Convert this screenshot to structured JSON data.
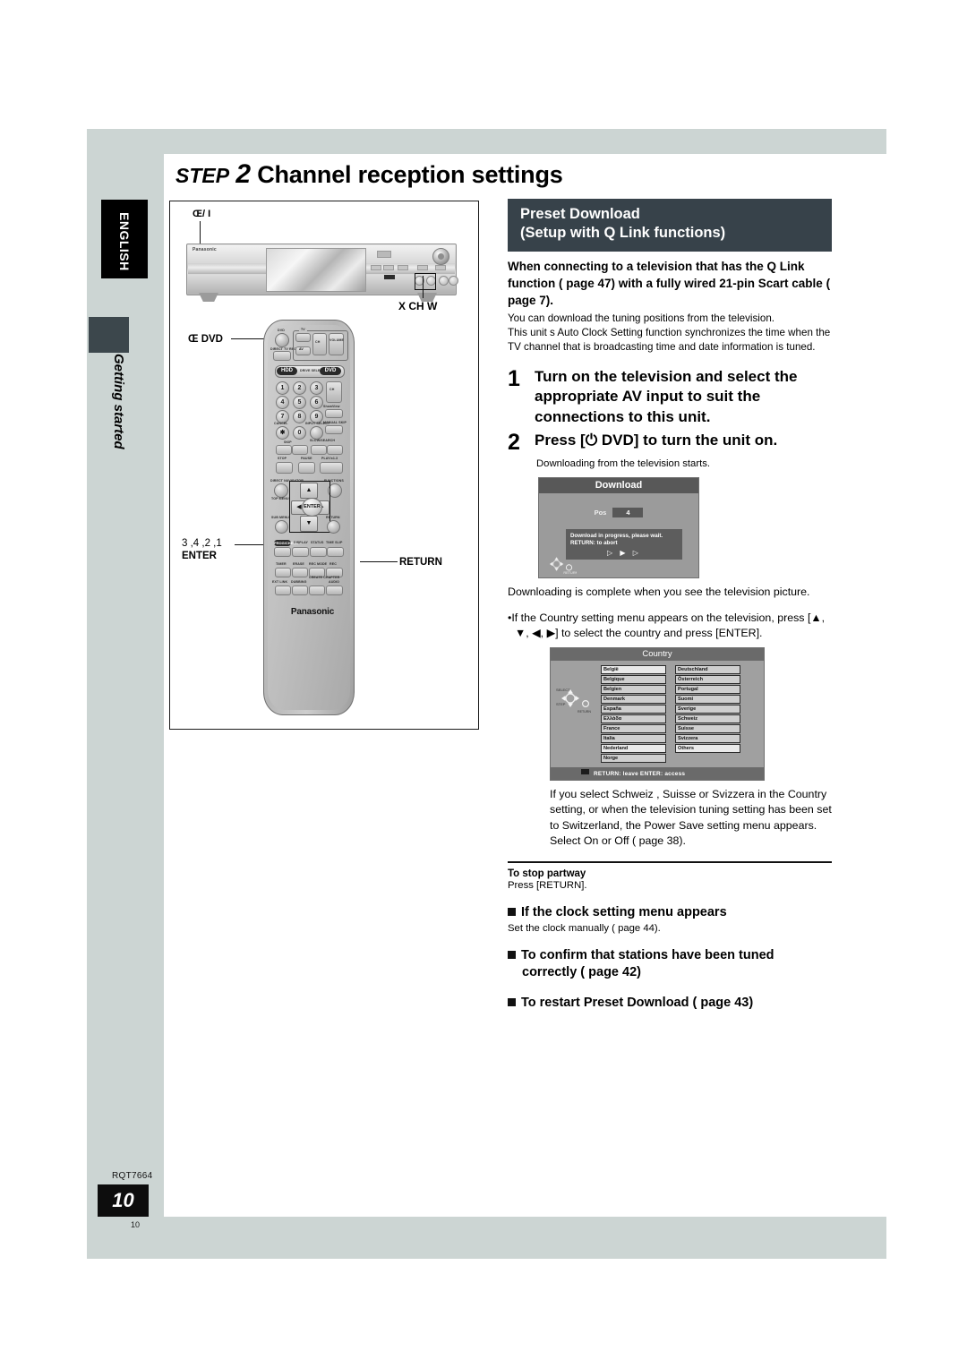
{
  "page": {
    "language_badge": "ENGLISH",
    "section_label": "Getting started",
    "doc_code": "RQT7664",
    "page_number": "10",
    "page_number_footer": "10"
  },
  "headline": {
    "step_word": "STEP",
    "step_number": "2",
    "title": "Channel reception settings"
  },
  "illustration": {
    "deck_power_label": "Œ/ I",
    "deck_ch_label": "X  CH W",
    "remote_power_label": "Œ DVD",
    "remote_dpad_label": "3 ,4 ,2 ,1",
    "remote_enter_label": "ENTER",
    "remote_return_label": "RETURN",
    "brand": "Panasonic",
    "remote_keys": {
      "dvd": "DVD",
      "tv": "TV",
      "direct_tv_rec": "DIRECT TV REC",
      "av": "AV",
      "ch": "CH",
      "volume": "VOLUME",
      "hdd": "HDD",
      "drive_select": "DRIVE SELECT",
      "dvd_big": "DVD",
      "numbers": [
        "1",
        "2",
        "3",
        "4",
        "5",
        "6",
        "7",
        "8",
        "9",
        "0"
      ],
      "cancel": "CANCEL",
      "input_select": "INPUT SELECT",
      "showview": "ShowView",
      "manual_skip": "MANUAL SKIP",
      "skip": "SKIP",
      "slow_search": "SLOW/SEARCH",
      "stop": "STOP",
      "pause": "PAUSE",
      "play": "PLAY/x1.3",
      "direct_navigator": "DIRECT NAVIGATOR",
      "top_menu": "TOP MENU",
      "functions": "FUNCTIONS",
      "sub_menu": "SUB MENU",
      "return": "RETURN",
      "enter": "ENTER",
      "prog_check": "PROG/CHECK",
      "display": "DISPLAY",
      "status": "STATUS",
      "time_slip": "TIME SLIP",
      "timer": "TIMER",
      "erase": "ERASE",
      "rec_mode": "REC MODE",
      "rec": "REC",
      "ext_link": "EXT LINK",
      "dubbing": "DUBBING",
      "create_chapter": "CREATE CHAPTER",
      "audio": "AUDIO"
    }
  },
  "right_column": {
    "header_line1": "Preset Download",
    "header_line2": "(Setup with Q Link functions)",
    "bold_lead": "When connecting to a television that has the Q Link function (  page 47) with a fully wired 21-pin Scart cable (  page 7).",
    "body_1": "You can download the tuning positions from the television.",
    "body_2": "This unit s Auto Clock Setting function synchronizes the time when the TV channel that is broadcasting time and date information is tuned.",
    "step1_num": "1",
    "step1_text": "Turn on the television and select the appropriate AV input to suit the connections to this unit.",
    "step2_num": "2",
    "step2_text": "Press [⏻ DVD] to turn the unit on.",
    "step2_sub": "Downloading from the television starts.",
    "after_osd_text": "Downloading is complete when you see the television picture.",
    "bullet_country": "•If the Country setting menu appears on the television, press [▲, ▼, ◀, ▶] to select the country and press [ENTER].",
    "swiss_note": "If you select  Schweiz ,  Suisse  or  Svizzera  in the Country setting, or when the television tuning setting has been set to Switzerland, the  Power Save  setting menu appears. Select  On  or  Off  (  page 38).",
    "stop_partway_title": "To stop partway",
    "stop_partway_text": "Press [RETURN].",
    "clock_heading": "If the clock setting menu appears",
    "clock_text": "Set the clock manually (  page 44).",
    "confirm_heading": "To confirm that stations have been tuned correctly (  page 42)",
    "restart_heading": "To restart Preset Download (  page 43)"
  },
  "osd_download": {
    "title": "Download",
    "pos_label": "Pos",
    "pos_value": "4",
    "message_line1": "Download in progress, please wait.",
    "message_line2": "RETURN:  to abort",
    "progress_glyphs": "▷ ▶ ▷",
    "nav_return": "RETURN"
  },
  "osd_country": {
    "title": "Country",
    "column_left": [
      "België",
      "Belgique",
      "Belgien",
      "Denmark",
      "España",
      "Ελλάδα",
      "France",
      "Italia",
      "Nederland",
      "Norge"
    ],
    "column_right": [
      "Deutschland",
      "Österreich",
      "Portugal",
      "Suomi",
      "Sverige",
      "Schweiz",
      "Suisse",
      "Svizzera",
      "Others"
    ],
    "selected_left": [
      "België",
      "Nederland"
    ],
    "selected_right": [
      "Others"
    ],
    "footer": "RETURN: leave   ENTER: access",
    "nav_select": "SELECT",
    "nav_step": "STEP",
    "nav_return": "RETURN"
  },
  "colors": {
    "page_gray": "#ccd5d3",
    "header_dark": "#37424a",
    "badge_black": "#000000"
  }
}
